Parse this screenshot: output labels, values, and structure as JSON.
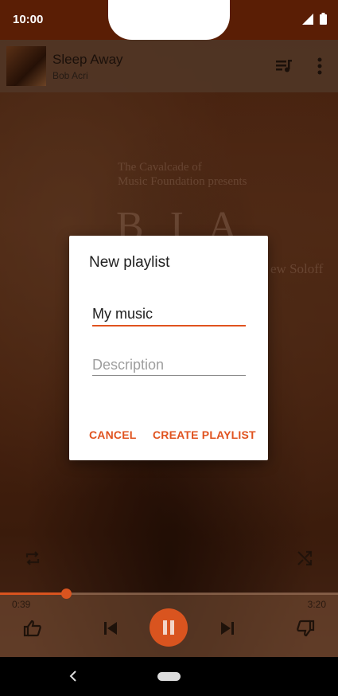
{
  "status_bar": {
    "time": "10:00"
  },
  "now_playing": {
    "title": "Sleep Away",
    "artist": "Bob Acri",
    "elapsed": "0:39",
    "duration": "3:20",
    "progress": 0.195
  },
  "album_art_text": {
    "line1": "The Cavalcade of",
    "line2": "Music Foundation presents",
    "big": "B I A",
    "line3": "ew Soloff"
  },
  "dialog": {
    "title": "New playlist",
    "name_value": "My music",
    "description_placeholder": "Description",
    "cancel_label": "CANCEL",
    "create_label": "CREATE PLAYLIST"
  },
  "colors": {
    "accent": "#d9541f",
    "status_bar": "#5a1e05"
  },
  "icons": {
    "queue": "queue-music-icon",
    "overflow": "more-vert-icon",
    "repeat": "repeat-icon",
    "shuffle": "shuffle-icon",
    "thumbs_up": "thumb-up-icon",
    "previous": "skip-previous-icon",
    "pause": "pause-icon",
    "next": "skip-next-icon",
    "thumbs_down": "thumb-down-icon",
    "back": "nav-back-icon",
    "home": "nav-home-icon"
  }
}
